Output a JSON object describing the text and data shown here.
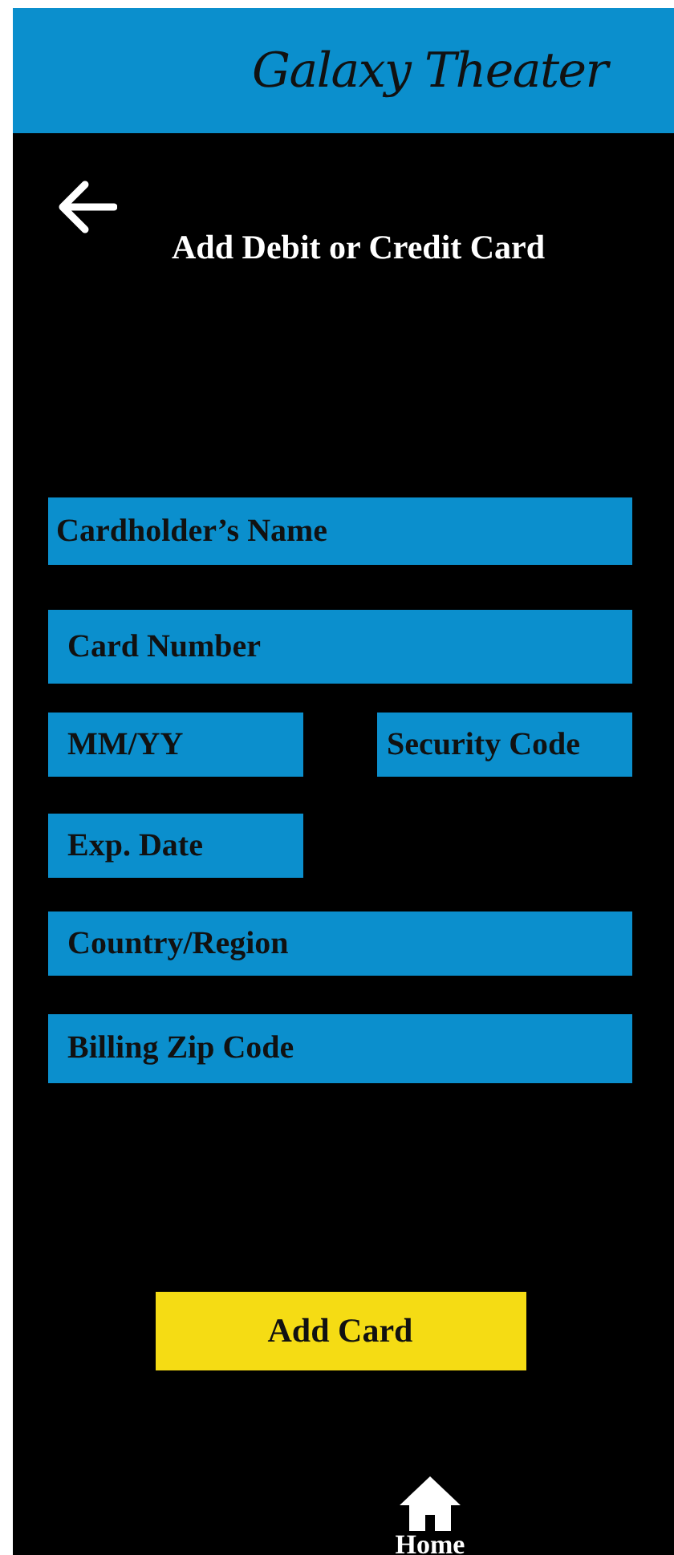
{
  "header": {
    "title": "Galaxy Theater"
  },
  "page": {
    "title": "Add Debit or Credit Card"
  },
  "fields": [
    {
      "placeholder": "Cardholder’s Name",
      "kind": "full"
    },
    {
      "placeholder": "Card Number",
      "kind": "full"
    },
    {
      "placeholder": "MM/YY",
      "kind": "half"
    },
    {
      "placeholder": "Security Code",
      "kind": "half"
    },
    {
      "placeholder": "Exp. Date",
      "kind": "half"
    },
    {
      "placeholder": "Country/Region",
      "kind": "full"
    },
    {
      "placeholder": "Billing Zip Code",
      "kind": "full"
    }
  ],
  "submit_button": "Add Card",
  "nav": [
    {
      "label": "Home"
    }
  ]
}
